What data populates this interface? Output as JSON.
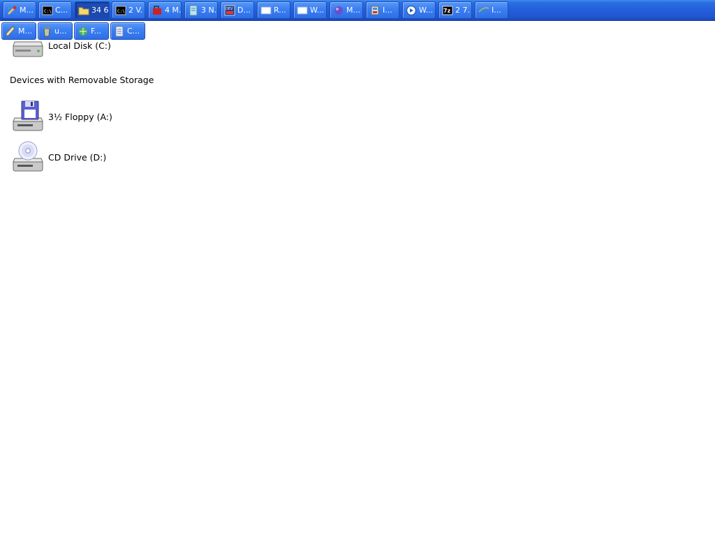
{
  "explorer": {
    "drives_hard": [
      {
        "label": "Local Disk (C:)",
        "icon": "hard-drive-icon"
      }
    ],
    "removable_header": "Devices with Removable Storage",
    "drives_removable": [
      {
        "label": "3½ Floppy (A:)",
        "icon": "floppy-drive-icon"
      },
      {
        "label": "CD Drive (D:)",
        "icon": "cd-drive-icon"
      }
    ]
  },
  "taskbar": {
    "row1": [
      {
        "label": "M...",
        "icon": "paint-icon"
      },
      {
        "label": "C...",
        "icon": "command-prompt-icon"
      },
      {
        "label": "34 6",
        "icon": "folder-icon",
        "active": true
      },
      {
        "label": "2 V.",
        "icon": "command-prompt-icon"
      },
      {
        "label": "4 M.",
        "icon": "mail-icon"
      },
      {
        "label": "3 N.",
        "icon": "notepad-icon"
      },
      {
        "label": "D...",
        "icon": "dev-icon"
      },
      {
        "label": "R...",
        "icon": "window-icon"
      },
      {
        "label": "W...",
        "icon": "window-icon"
      },
      {
        "label": "M...",
        "icon": "msn-icon"
      },
      {
        "label": "I...",
        "icon": "installer-icon"
      },
      {
        "label": "W...",
        "icon": "media-player-icon"
      },
      {
        "label": "2 7.",
        "icon": "7zip-icon"
      },
      {
        "label": "I...",
        "icon": "internet-explorer-icon"
      }
    ],
    "row2": [
      {
        "label": "M...",
        "icon": "pen-icon"
      },
      {
        "label": "u...",
        "icon": "recycle-icon"
      },
      {
        "label": "F...",
        "icon": "network-icon"
      },
      {
        "label": "C...",
        "icon": "document-icon"
      }
    ]
  }
}
